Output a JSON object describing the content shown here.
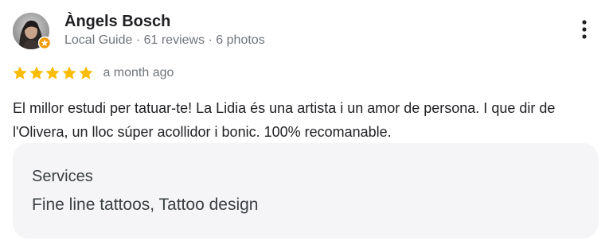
{
  "reviewer": {
    "name": "Àngels Bosch",
    "meta": "Local Guide · 61 reviews · 6 photos",
    "avatar_icon": "user-avatar",
    "badge_icon": "local-guide-badge-icon"
  },
  "menu": {
    "icon": "more-vertical-icon"
  },
  "rating": {
    "stars": 5,
    "max": 5,
    "star_color": "#fbbc04",
    "time": "a month ago"
  },
  "review": {
    "text": "El millor estudi per tatuar-te! La Lidia és una artista i un amor de persona. I que dir de l'Olivera, un lloc súper acollidor i bonic. 100% recomanable."
  },
  "services": {
    "title": "Services",
    "value": "Fine line tattoos, Tattoo design"
  },
  "colors": {
    "primary_text": "#202124",
    "secondary_text": "#70757a",
    "services_bg": "#f5f5f7"
  }
}
